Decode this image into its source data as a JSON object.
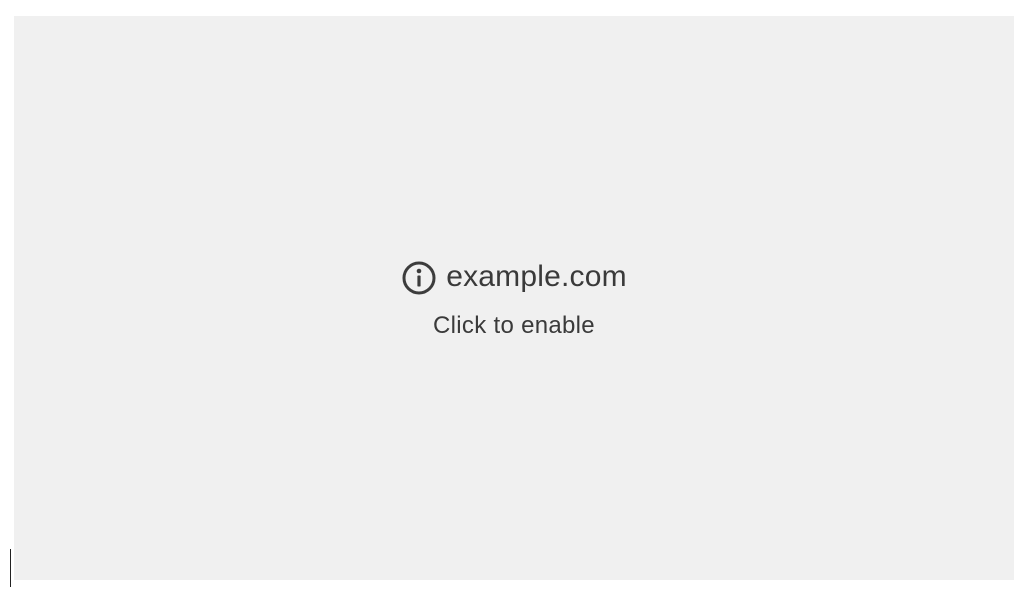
{
  "placeholder": {
    "site": "example.com",
    "action_text": "Click to enable",
    "icon": "info-icon"
  },
  "colors": {
    "background": "#f0f0f0",
    "text": "#3a3a3a"
  }
}
